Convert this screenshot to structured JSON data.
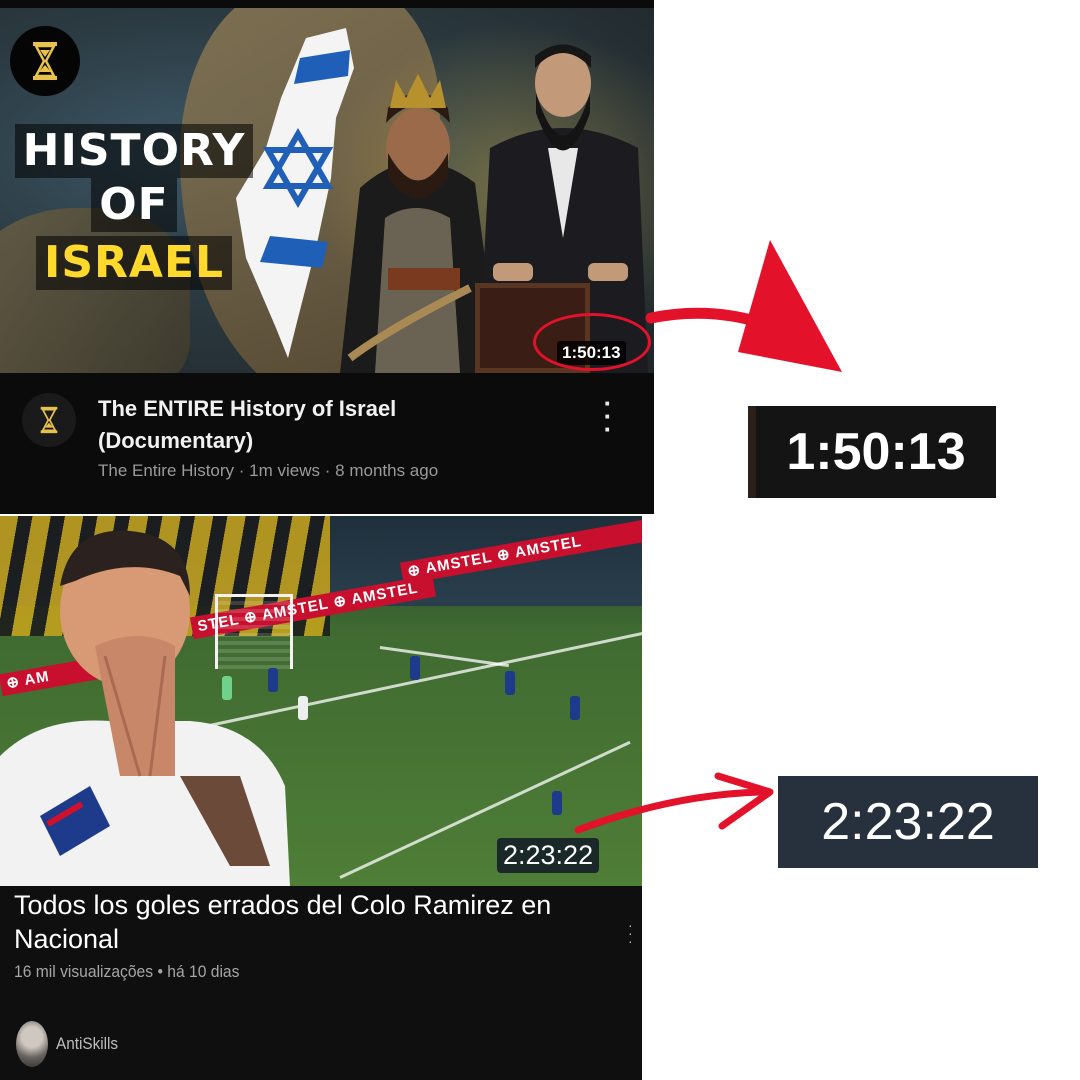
{
  "video1": {
    "thumbnail_title_lines": [
      "HISTORY",
      "OF",
      "ISRAEL"
    ],
    "duration": "1:50:13",
    "title": "The ENTIRE History of Israel (Documentary)",
    "channel": "The Entire History",
    "views": "1m views",
    "age": "8 months ago",
    "channel_icon": "hourglass-icon"
  },
  "video2": {
    "duration": "2:23:22",
    "title": "Todos los goles errados del Colo Ramirez en Nacional",
    "views": "16 mil visualizações",
    "age": "há 10 dias",
    "channel": "AntiSkills",
    "stadium_boards": [
      "AMSTEL",
      "AMSTEL",
      "AMSTEL",
      "AMSTEL",
      "STEL",
      "AM"
    ]
  },
  "zoom1": {
    "text": "1:50:13"
  },
  "zoom2": {
    "text": "2:23:22"
  },
  "colors": {
    "annotation_red": "#e3112a",
    "yellow_text": "#ffd92b"
  }
}
